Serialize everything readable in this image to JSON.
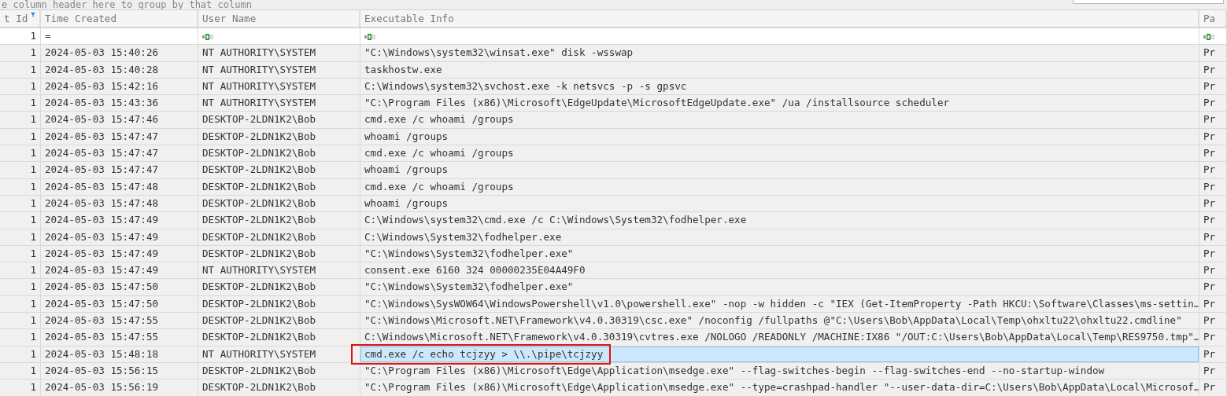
{
  "group_panel": {
    "hint": "e column header here to group by that column"
  },
  "columns": [
    {
      "label": "t Id",
      "filtered": true
    },
    {
      "label": "Time Created",
      "filtered": false
    },
    {
      "label": "User Name",
      "filtered": false
    },
    {
      "label": "Executable Info",
      "filtered": false
    },
    {
      "label": "Pa",
      "filtered": false
    }
  ],
  "filter_row": [
    {
      "kind": "text",
      "value": "1"
    },
    {
      "kind": "text",
      "value": "="
    },
    {
      "kind": "icon"
    },
    {
      "kind": "icon"
    },
    {
      "kind": "icon"
    }
  ],
  "rows": [
    {
      "event_id": "1",
      "time_created": "2024-05-03 15:40:26",
      "user_name": "NT AUTHORITY\\SYSTEM",
      "executable_info": "\"C:\\Windows\\system32\\winsat.exe\" disk -wsswap",
      "column_5": "Pr",
      "selected": false,
      "annotated": false
    },
    {
      "event_id": "1",
      "time_created": "2024-05-03 15:40:28",
      "user_name": "NT AUTHORITY\\SYSTEM",
      "executable_info": "taskhostw.exe",
      "column_5": "Pr",
      "selected": false,
      "annotated": false
    },
    {
      "event_id": "1",
      "time_created": "2024-05-03 15:42:16",
      "user_name": "NT AUTHORITY\\SYSTEM",
      "executable_info": "C:\\Windows\\system32\\svchost.exe -k netsvcs -p -s gpsvc",
      "column_5": "Pr",
      "selected": false,
      "annotated": false
    },
    {
      "event_id": "1",
      "time_created": "2024-05-03 15:43:36",
      "user_name": "NT AUTHORITY\\SYSTEM",
      "executable_info": "\"C:\\Program Files (x86)\\Microsoft\\EdgeUpdate\\MicrosoftEdgeUpdate.exe\" /ua /installsource scheduler",
      "column_5": "Pr",
      "selected": false,
      "annotated": false
    },
    {
      "event_id": "1",
      "time_created": "2024-05-03 15:47:46",
      "user_name": "DESKTOP-2LDN1K2\\Bob",
      "executable_info": "cmd.exe /c whoami /groups",
      "column_5": "Pr",
      "selected": false,
      "annotated": false
    },
    {
      "event_id": "1",
      "time_created": "2024-05-03 15:47:47",
      "user_name": "DESKTOP-2LDN1K2\\Bob",
      "executable_info": "whoami  /groups",
      "column_5": "Pr",
      "selected": false,
      "annotated": false
    },
    {
      "event_id": "1",
      "time_created": "2024-05-03 15:47:47",
      "user_name": "DESKTOP-2LDN1K2\\Bob",
      "executable_info": "cmd.exe /c whoami /groups",
      "column_5": "Pr",
      "selected": false,
      "annotated": false
    },
    {
      "event_id": "1",
      "time_created": "2024-05-03 15:47:47",
      "user_name": "DESKTOP-2LDN1K2\\Bob",
      "executable_info": "whoami  /groups",
      "column_5": "Pr",
      "selected": false,
      "annotated": false
    },
    {
      "event_id": "1",
      "time_created": "2024-05-03 15:47:48",
      "user_name": "DESKTOP-2LDN1K2\\Bob",
      "executable_info": "cmd.exe /c whoami /groups",
      "column_5": "Pr",
      "selected": false,
      "annotated": false
    },
    {
      "event_id": "1",
      "time_created": "2024-05-03 15:47:48",
      "user_name": "DESKTOP-2LDN1K2\\Bob",
      "executable_info": "whoami  /groups",
      "column_5": "Pr",
      "selected": false,
      "annotated": false
    },
    {
      "event_id": "1",
      "time_created": "2024-05-03 15:47:49",
      "user_name": "DESKTOP-2LDN1K2\\Bob",
      "executable_info": "C:\\Windows\\system32\\cmd.exe /c C:\\Windows\\System32\\fodhelper.exe",
      "column_5": "Pr",
      "selected": false,
      "annotated": false
    },
    {
      "event_id": "1",
      "time_created": "2024-05-03 15:47:49",
      "user_name": "DESKTOP-2LDN1K2\\Bob",
      "executable_info": "C:\\Windows\\System32\\fodhelper.exe",
      "column_5": "Pr",
      "selected": false,
      "annotated": false
    },
    {
      "event_id": "1",
      "time_created": "2024-05-03 15:47:49",
      "user_name": "DESKTOP-2LDN1K2\\Bob",
      "executable_info": "\"C:\\Windows\\System32\\fodhelper.exe\"",
      "column_5": "Pr",
      "selected": false,
      "annotated": false
    },
    {
      "event_id": "1",
      "time_created": "2024-05-03 15:47:49",
      "user_name": "NT AUTHORITY\\SYSTEM",
      "executable_info": "consent.exe 6160 324 00000235E04A49F0",
      "column_5": "Pr",
      "selected": false,
      "annotated": false
    },
    {
      "event_id": "1",
      "time_created": "2024-05-03 15:47:50",
      "user_name": "DESKTOP-2LDN1K2\\Bob",
      "executable_info": "\"C:\\Windows\\System32\\fodhelper.exe\"",
      "column_5": "Pr",
      "selected": false,
      "annotated": false
    },
    {
      "event_id": "1",
      "time_created": "2024-05-03 15:47:50",
      "user_name": "DESKTOP-2LDN1K2\\Bob",
      "executable_info": "\"C:\\Windows\\SysWOW64\\WindowsPowershell\\v1.0\\powershell.exe\" -nop -w hidden -c \"IEX (Get-ItemProperty -Path HKCU:\\Software\\Classes\\ms-settin…",
      "column_5": "Pr",
      "selected": false,
      "annotated": false
    },
    {
      "event_id": "1",
      "time_created": "2024-05-03 15:47:55",
      "user_name": "DESKTOP-2LDN1K2\\Bob",
      "executable_info": "\"C:\\Windows\\Microsoft.NET\\Framework\\v4.0.30319\\csc.exe\" /noconfig /fullpaths @\"C:\\Users\\Bob\\AppData\\Local\\Temp\\ohxltu22\\ohxltu22.cmdline\"",
      "column_5": "Pr",
      "selected": false,
      "annotated": false
    },
    {
      "event_id": "1",
      "time_created": "2024-05-03 15:47:55",
      "user_name": "DESKTOP-2LDN1K2\\Bob",
      "executable_info": "C:\\Windows\\Microsoft.NET\\Framework\\v4.0.30319\\cvtres.exe /NOLOGO /READONLY /MACHINE:IX86 \"/OUT:C:\\Users\\Bob\\AppData\\Local\\Temp\\RES9750.tmp\"…",
      "column_5": "Pr",
      "selected": false,
      "annotated": false
    },
    {
      "event_id": "1",
      "time_created": "2024-05-03 15:48:18",
      "user_name": "NT AUTHORITY\\SYSTEM",
      "executable_info": "cmd.exe /c echo tcjzyy > \\\\.\\pipe\\tcjzyy",
      "column_5": "Pr",
      "selected": true,
      "annotated": true
    },
    {
      "event_id": "1",
      "time_created": "2024-05-03 15:56:15",
      "user_name": "DESKTOP-2LDN1K2\\Bob",
      "executable_info": "\"C:\\Program Files (x86)\\Microsoft\\Edge\\Application\\msedge.exe\" --flag-switches-begin --flag-switches-end --no-startup-window",
      "column_5": "Pr",
      "selected": false,
      "annotated": false
    },
    {
      "event_id": "1",
      "time_created": "2024-05-03 15:56:19",
      "user_name": "DESKTOP-2LDN1K2\\Bob",
      "executable_info": "\"C:\\Program Files (x86)\\Microsoft\\Edge\\Application\\msedge.exe\" --type=crashpad-handler \"--user-data-dir=C:\\Users\\Bob\\AppData\\Local\\Microsof…",
      "column_5": "Pr",
      "selected": false,
      "annotated": false
    }
  ]
}
